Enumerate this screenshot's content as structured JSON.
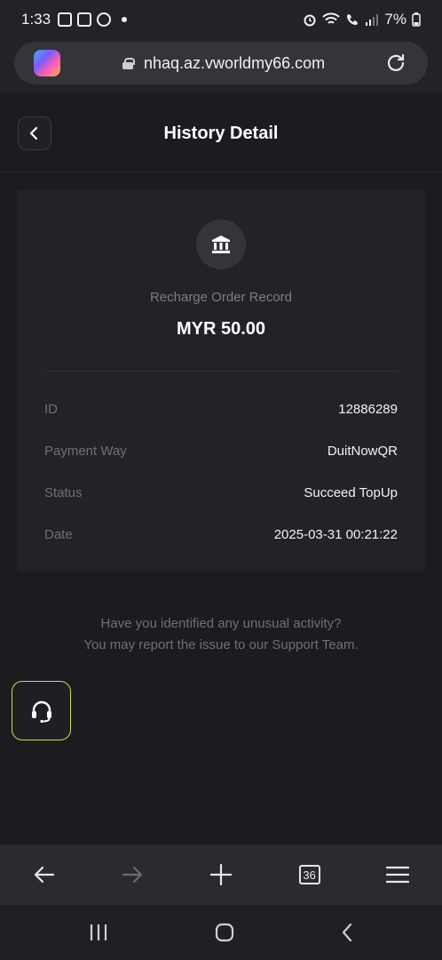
{
  "status_bar": {
    "time": "1:33",
    "battery": "7%",
    "icons_left": [
      "image-icon",
      "instagram-icon",
      "m-app-icon"
    ],
    "icons_right": [
      "alarm-icon",
      "wifi-icon",
      "call-icon",
      "signal-icon",
      "battery-icon"
    ]
  },
  "browser": {
    "url": "nhaq.az.vworldmy66.com",
    "tab_count": "36"
  },
  "header": {
    "title": "History Detail"
  },
  "record": {
    "type_label": "Recharge Order Record",
    "amount": "MYR 50.00",
    "rows": [
      {
        "label": "ID",
        "value": "12886289"
      },
      {
        "label": "Payment Way",
        "value": "DuitNowQR"
      },
      {
        "label": "Status",
        "value": "Succeed TopUp"
      },
      {
        "label": "Date",
        "value": "2025-03-31 00:21:22"
      }
    ]
  },
  "notice": {
    "line1": "Have you identified any unusual activity?",
    "line2": "You may report the issue to our Support Team."
  },
  "colors": {
    "background": "#1b1c20",
    "card": "#222327",
    "support_border": "#cfd85a"
  }
}
